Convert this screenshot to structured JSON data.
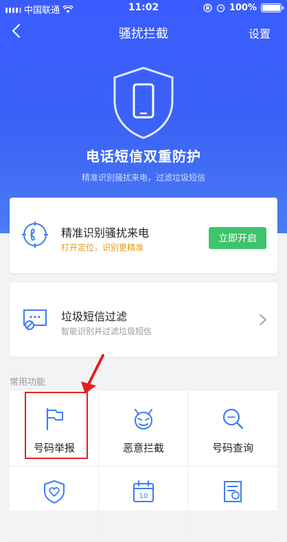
{
  "status_bar": {
    "carrier": "中国联通",
    "time": "11:02",
    "battery": "100%"
  },
  "nav": {
    "title": "骚扰拦截",
    "settings": "设置"
  },
  "hero": {
    "title": "电话短信双重防护",
    "subtitle": "精准识别骚扰来电，过滤垃圾短信"
  },
  "cards": [
    {
      "title": "精准识别骚扰来电",
      "subtitle": "打开定位，识别更精准",
      "button": "立即开启"
    },
    {
      "title": "垃圾短信过滤",
      "subtitle": "智能识别并过滤垃圾短信"
    }
  ],
  "section": {
    "label": "常用功能"
  },
  "functions": [
    {
      "label": "号码举报",
      "icon": "flag-icon"
    },
    {
      "label": "恶意拦截",
      "icon": "devil-icon"
    },
    {
      "label": "号码查询",
      "icon": "search-icon"
    },
    {
      "label": "",
      "icon": "heart-shield-icon"
    },
    {
      "label": "",
      "icon": "calendar-icon"
    },
    {
      "label": "",
      "icon": "document-stamp-icon"
    }
  ],
  "colors": {
    "hero_blue": "#3b5ff5",
    "green_button": "#3ec46d",
    "orange_text": "#e49b12",
    "highlight_red": "#e02020",
    "icon_blue": "#3b7cf6"
  }
}
